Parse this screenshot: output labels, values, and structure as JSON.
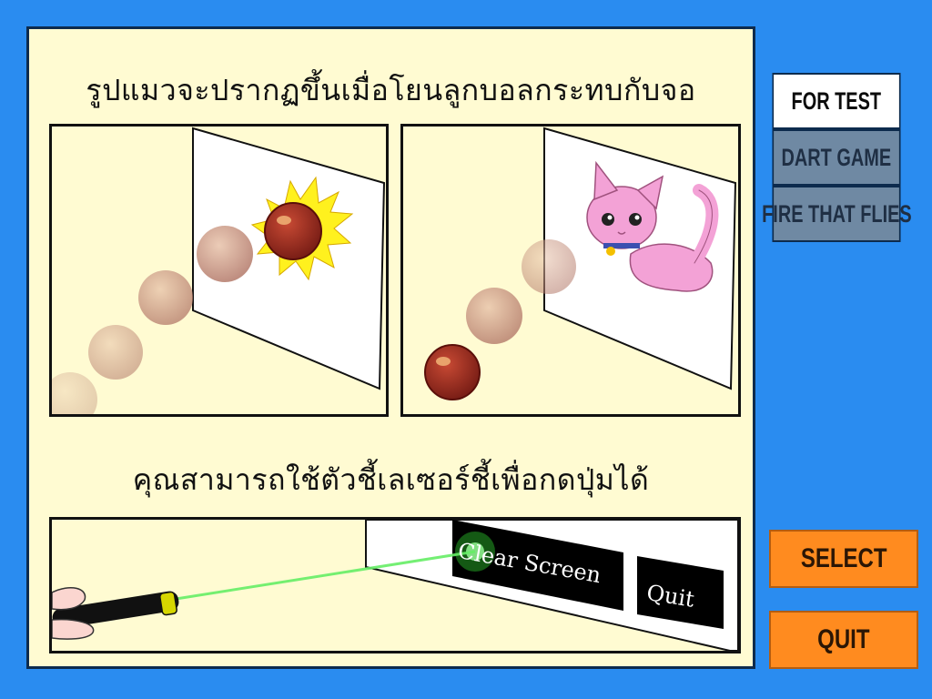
{
  "panel": {
    "caption_top": "รูปแมวจะปรากฏขึ้นเมื่อโยนลูกบอลกระทบกับจอ",
    "caption_bottom": "คุณสามารถใช้ตัวชี้เลเซอร์ชี้เพื่อกดปุ่มได้",
    "illustration_screen": {
      "clear_label": "Clear Screen",
      "quit_label": "Quit"
    }
  },
  "tabs": [
    {
      "label": "FOR TEST",
      "active": true
    },
    {
      "label": "DART GAME",
      "active": false
    },
    {
      "label": "FIRE THAT FLIES",
      "active": false
    }
  ],
  "buttons": {
    "select_label": "SELECT",
    "quit_label": "QUIT"
  },
  "colors": {
    "background": "#2a8cf0",
    "panel": "#fffbd2",
    "tab_active": "#ffffff",
    "tab_inactive": "#6f89a3",
    "button": "#ff8b1f",
    "laser": "#55ee55",
    "ball": "#a32d1d",
    "cat": "#f3a2d6"
  }
}
